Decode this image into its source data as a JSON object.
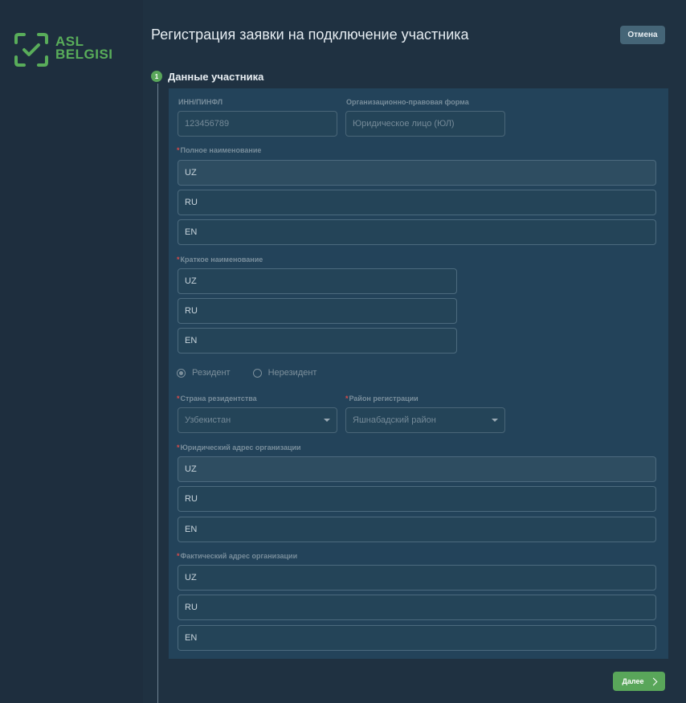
{
  "brand": {
    "line1": "ASL",
    "line2": "BELGISI",
    "color": "#59ad5a"
  },
  "header": {
    "title": "Регистрация заявки на подключение участника",
    "cancel_label": "Отмена"
  },
  "step": {
    "number": "1",
    "title": "Данные участника"
  },
  "form": {
    "inn": {
      "label": "ИНН/ПИНФЛ",
      "value": "123456789"
    },
    "legal_form": {
      "label": "Организационно-правовая форма",
      "value": "Юридическое лицо (ЮЛ)"
    },
    "full_name": {
      "label": "Полное наименование",
      "uz": "UZ",
      "ru": "RU",
      "en": "EN"
    },
    "short_name": {
      "label": "Краткое наименование",
      "uz": "UZ",
      "ru": "RU",
      "en": "EN"
    },
    "residency": {
      "resident": "Резидент",
      "nonresident": "Нерезидент",
      "selected": "Резидент"
    },
    "country": {
      "label": "Страна резидентства",
      "value": "Узбекистан"
    },
    "district": {
      "label": "Район регистрации",
      "value": "Яшнабадский район"
    },
    "legal_address": {
      "label": "Юридический адрес организации",
      "uz": "UZ",
      "ru": "RU",
      "en": "EN"
    },
    "actual_address": {
      "label": "Фактический адрес организации",
      "uz": "UZ",
      "ru": "RU",
      "en": "EN"
    },
    "required_mark": "*"
  },
  "footer": {
    "next_label": "Далее"
  },
  "colors": {
    "accent": "#59a65a",
    "required": "#d94b4b",
    "cancel_bg": "#456577"
  }
}
